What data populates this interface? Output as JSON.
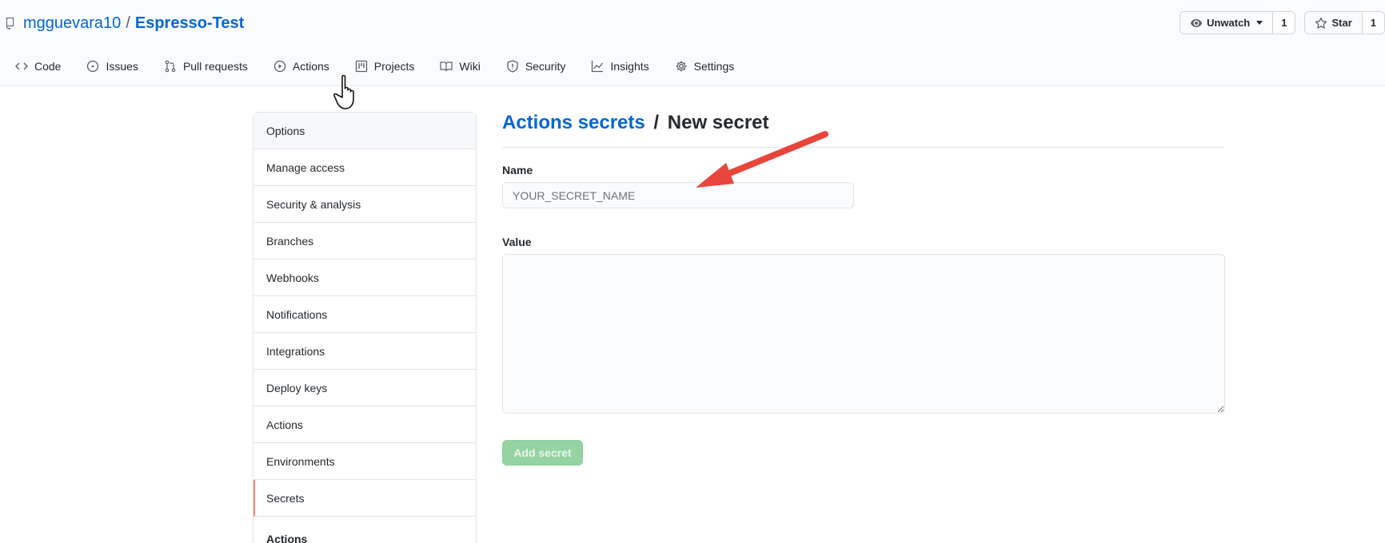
{
  "repo": {
    "owner": "mgguevara10",
    "separator": "/",
    "name": "Espresso-Test"
  },
  "watch": {
    "label": "Unwatch",
    "count": "1"
  },
  "star": {
    "label": "Star",
    "count": "1"
  },
  "tabs": [
    {
      "label": "Code",
      "icon": "code-icon"
    },
    {
      "label": "Issues",
      "icon": "issue-icon"
    },
    {
      "label": "Pull requests",
      "icon": "pull-request-icon"
    },
    {
      "label": "Actions",
      "icon": "play-icon"
    },
    {
      "label": "Projects",
      "icon": "project-icon"
    },
    {
      "label": "Wiki",
      "icon": "book-icon"
    },
    {
      "label": "Security",
      "icon": "shield-icon"
    },
    {
      "label": "Insights",
      "icon": "graph-icon"
    },
    {
      "label": "Settings",
      "icon": "gear-icon"
    }
  ],
  "sidebar": {
    "items": [
      {
        "label": "Options"
      },
      {
        "label": "Manage access"
      },
      {
        "label": "Security & analysis"
      },
      {
        "label": "Branches"
      },
      {
        "label": "Webhooks"
      },
      {
        "label": "Notifications"
      },
      {
        "label": "Integrations"
      },
      {
        "label": "Deploy keys"
      },
      {
        "label": "Actions"
      },
      {
        "label": "Environments"
      },
      {
        "label": "Secrets"
      }
    ],
    "active": "Secrets",
    "section_heading": "Actions"
  },
  "main": {
    "breadcrumb": "Actions secrets",
    "separator": "/",
    "title": "New secret",
    "name_label": "Name",
    "name_placeholder": "YOUR_SECRET_NAME",
    "name_value": "",
    "value_label": "Value",
    "value_value": "",
    "submit_label": "Add secret"
  },
  "colors": {
    "link": "#0366d6",
    "active_marker": "#f9826c",
    "submit_disabled": "#94d3a2",
    "annotation_arrow": "#e8453c"
  }
}
